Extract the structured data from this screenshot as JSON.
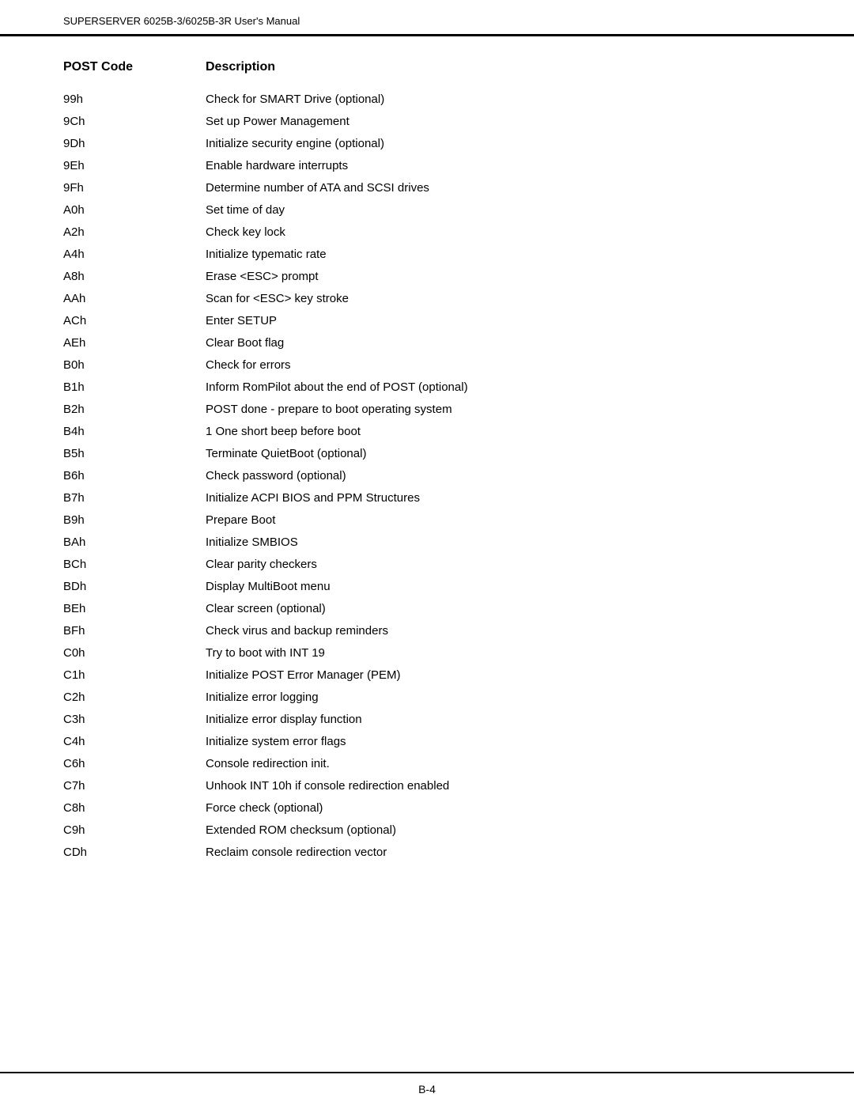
{
  "header": {
    "text": "SUPERSERVER 6025B-3/6025B-3R User's Manual"
  },
  "table": {
    "col1_label": "POST Code",
    "col2_label": "Description",
    "rows": [
      {
        "code": "99h",
        "desc": "Check for SMART Drive (optional)"
      },
      {
        "code": "9Ch",
        "desc": "Set up Power Management"
      },
      {
        "code": "9Dh",
        "desc": "Initialize security engine (optional)"
      },
      {
        "code": "9Eh",
        "desc": "Enable hardware interrupts"
      },
      {
        "code": "9Fh",
        "desc": "Determine number of ATA and SCSI drives"
      },
      {
        "code": "A0h",
        "desc": "Set time of day"
      },
      {
        "code": "A2h",
        "desc": "Check key lock"
      },
      {
        "code": "A4h",
        "desc": "Initialize typematic rate"
      },
      {
        "code": "A8h",
        "desc": "Erase <ESC> prompt"
      },
      {
        "code": "AAh",
        "desc": "Scan for <ESC> key stroke"
      },
      {
        "code": "ACh",
        "desc": "Enter SETUP"
      },
      {
        "code": "AEh",
        "desc": "Clear Boot flag"
      },
      {
        "code": "B0h",
        "desc": "Check for errors"
      },
      {
        "code": "B1h",
        "desc": "Inform RomPilot about the end of POST (optional)"
      },
      {
        "code": "B2h",
        "desc": "POST done - prepare to boot operating system"
      },
      {
        "code": "B4h",
        "desc": "1 One short beep before boot"
      },
      {
        "code": "B5h",
        "desc": "Terminate QuietBoot (optional)"
      },
      {
        "code": "B6h",
        "desc": "Check password (optional)"
      },
      {
        "code": "B7h",
        "desc": "Initialize ACPI BIOS and PPM Structures"
      },
      {
        "code": "B9h",
        "desc": "Prepare Boot"
      },
      {
        "code": "BAh",
        "desc": "Initialize SMBIOS"
      },
      {
        "code": "BCh",
        "desc": "Clear parity checkers"
      },
      {
        "code": "BDh",
        "desc": "Display MultiBoot menu"
      },
      {
        "code": "BEh",
        "desc": "Clear screen (optional)"
      },
      {
        "code": "BFh",
        "desc": "Check virus and backup reminders"
      },
      {
        "code": "C0h",
        "desc": "Try to boot with INT 19"
      },
      {
        "code": "C1h",
        "desc": "Initialize POST Error Manager (PEM)"
      },
      {
        "code": "C2h",
        "desc": "Initialize error logging"
      },
      {
        "code": "C3h",
        "desc": "Initialize error display function"
      },
      {
        "code": "C4h",
        "desc": "Initialize system error flags"
      },
      {
        "code": "C6h",
        "desc": "Console redirection init."
      },
      {
        "code": "C7h",
        "desc": "Unhook INT 10h if console redirection enabled"
      },
      {
        "code": "C8h",
        "desc": "Force check (optional)"
      },
      {
        "code": "C9h",
        "desc": "Extended ROM checksum (optional)"
      },
      {
        "code": "CDh",
        "desc": "Reclaim console redirection vector"
      }
    ]
  },
  "footer": {
    "text": "B-4"
  }
}
